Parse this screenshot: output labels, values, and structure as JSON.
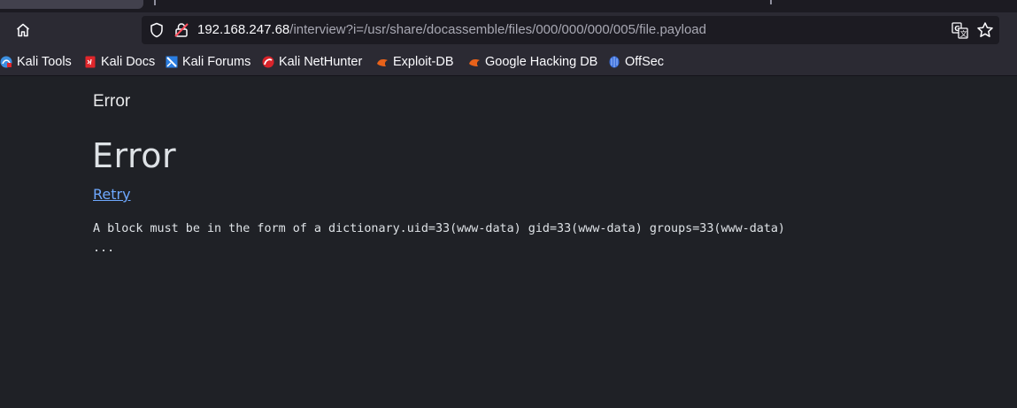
{
  "browser": {
    "url_host": "192.168.247.68",
    "url_path": "/interview?i=/usr/share/docassemble/files/000/000/000/005/file.payload",
    "icons": {
      "home": "home-icon",
      "shield": "shield-icon",
      "lock": "insecure-lock-icon",
      "translate": "translate-icon",
      "bookmark_star": "star-icon"
    }
  },
  "bookmarks": [
    {
      "label": "Kali Tools",
      "icon": "kali-tools-icon",
      "color": "#3d8fe0"
    },
    {
      "label": "Kali Docs",
      "icon": "kali-docs-icon",
      "color": "#e0262b"
    },
    {
      "label": "Kali Forums",
      "icon": "kali-forums-icon",
      "color": "#2a7de1"
    },
    {
      "label": "Kali NetHunter",
      "icon": "kali-nethunter-icon",
      "color": "#d8232a"
    },
    {
      "label": "Exploit-DB",
      "icon": "exploit-db-icon",
      "color": "#e8621a"
    },
    {
      "label": "Google Hacking DB",
      "icon": "ghdb-icon",
      "color": "#e8621a"
    },
    {
      "label": "OffSec",
      "icon": "offsec-icon",
      "color": "#3c6fd8"
    }
  ],
  "page": {
    "nav_title": "Error",
    "heading": "Error",
    "retry_label": "Retry",
    "error_message": "A block must be in the form of a dictionary.uid=33(www-data) gid=33(www-data) groups=33(www-data)\n..."
  },
  "colors": {
    "background": "#1f2126",
    "toolbar": "#2b2a33",
    "link": "#6ea8fe",
    "text": "#dee2e6"
  }
}
